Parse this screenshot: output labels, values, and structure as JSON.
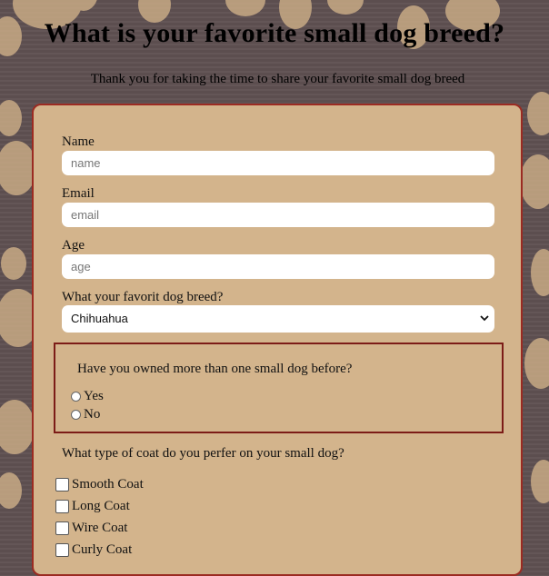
{
  "page": {
    "title": "What is your favorite small dog breed?",
    "subtitle": "Thank you for taking the time to share your favorite small dog breed"
  },
  "form": {
    "name": {
      "label": "Name",
      "placeholder": "name",
      "value": ""
    },
    "email": {
      "label": "Email",
      "placeholder": "email",
      "value": ""
    },
    "age": {
      "label": "Age",
      "placeholder": "age",
      "value": ""
    },
    "breed": {
      "label": "What your favorit dog breed?",
      "selected": "Chihuahua"
    },
    "owned": {
      "question": "Have you owned more than one small dog before?",
      "options": [
        "Yes",
        "No"
      ]
    },
    "coat": {
      "question": "What type of coat do you perfer on your small dog?",
      "options": [
        "Smooth Coat",
        "Long Coat",
        "Wire Coat",
        "Curly Coat"
      ]
    }
  },
  "colors": {
    "form_background": "#d3b48c",
    "form_border": "#9b2b22",
    "fieldset_border": "#7c1c17",
    "page_background": "#5f5152",
    "paw_print": "#c8aa85"
  },
  "icons": {
    "background_pattern": "paw-print-icon",
    "select_arrow": "chevron-down-icon"
  }
}
